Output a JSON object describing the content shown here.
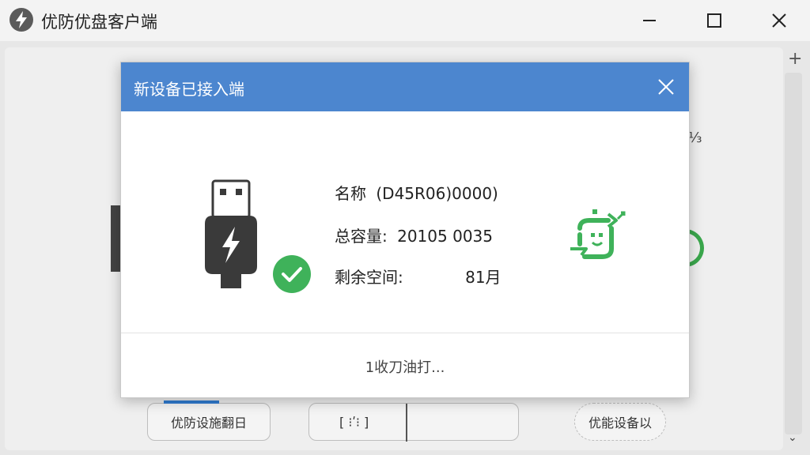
{
  "window": {
    "title": "优防优盘客户端",
    "controls": {
      "minimize": "minimize-icon",
      "maximize": "maximize-icon",
      "close": "close-icon"
    }
  },
  "background": {
    "right_text": "⅓",
    "buttons": [
      {
        "label": "优防设施翻日"
      },
      {
        "label": "[ ⁝ʹ⁝ ]"
      },
      {
        "label": "优能设备以"
      }
    ]
  },
  "dialog": {
    "title": "新设备已接入端",
    "device": {
      "name_label": "名称",
      "name_value": "(D45R06)0000)",
      "total_label": "总容量:",
      "total_value": "20105  0035",
      "free_label": "剩余空间:",
      "free_value": "81月"
    },
    "footer_text": "1收刀油打...",
    "colors": {
      "header": "#4c86cf",
      "success": "#3fb25a"
    },
    "icons": [
      "usb-drive-icon",
      "check-icon",
      "sync-icon",
      "close-icon"
    ]
  }
}
